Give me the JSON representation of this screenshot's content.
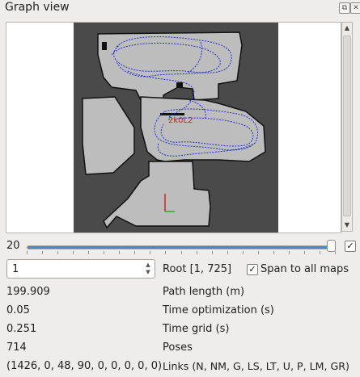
{
  "window": {
    "title": "Graph view",
    "float_icon": "float-icon",
    "close_icon": "close-icon"
  },
  "viewport": {
    "graph_label": "2k0L2",
    "colors": {
      "background": "#4a4a4a",
      "free_space": "#bdbdbd",
      "obstacle": "#111111",
      "path": "#1f2fd6",
      "loop_closure": "#d02020",
      "axis_x": "#20b020",
      "axis_y": "#d02020"
    }
  },
  "slider": {
    "value": "20",
    "fraction": 1.0,
    "accent": "#3a8bd8"
  },
  "slider_checkbox": {
    "checked": true
  },
  "root": {
    "spin_value": "1",
    "label": "Root [1, 725]",
    "span_checked": true,
    "span_label": "Span to all maps"
  },
  "stats": [
    {
      "value": "199.909",
      "label": "Path length (m)"
    },
    {
      "value": "0.05",
      "label": "Time optimization (s)"
    },
    {
      "value": "0.251",
      "label": "Time grid (s)"
    },
    {
      "value": "714",
      "label": "Poses"
    },
    {
      "value": "(1426, 0, 48, 90, 0, 0, 0, 0, 0)",
      "label": "Links (N, NM, G, LS, LT, U, P, LM, GR)"
    }
  ]
}
